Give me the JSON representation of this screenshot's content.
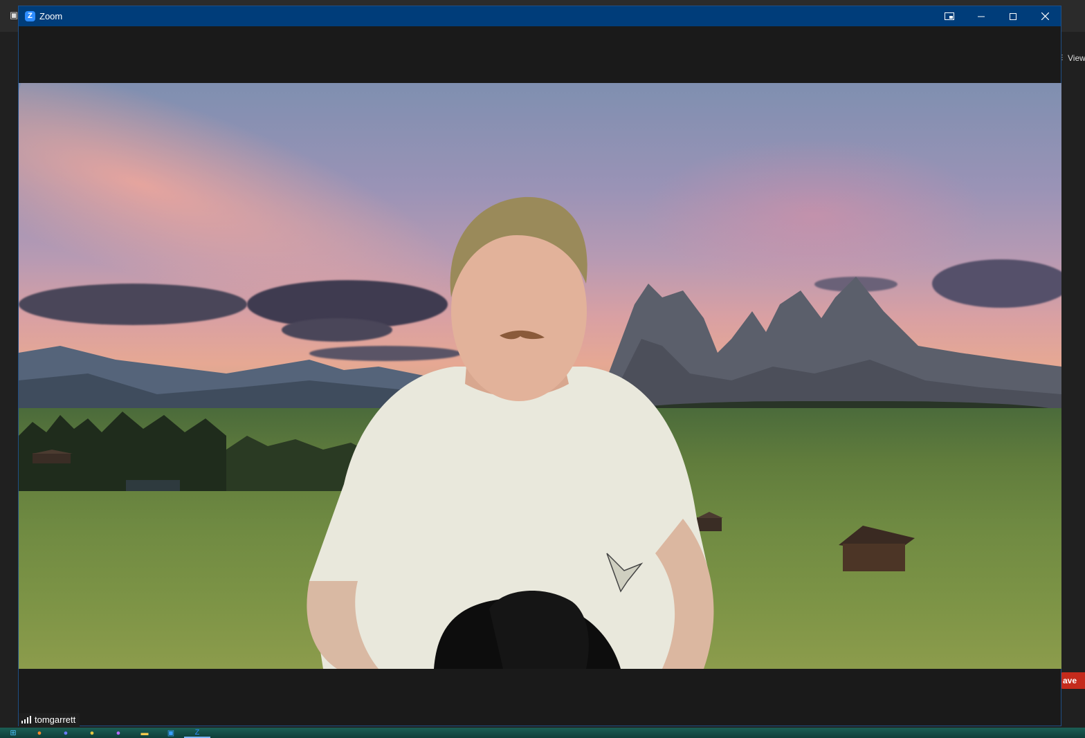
{
  "window": {
    "title": "Zoom",
    "controls": [
      "picture-in-picture-icon",
      "minimize-icon",
      "maximize-icon",
      "close-icon"
    ]
  },
  "background_app": {
    "view_label": "View",
    "leave_label": "ave"
  },
  "participant": {
    "name": "tomgarrett",
    "signal_bars": 4
  },
  "taskbar": {
    "items": [
      "windows-start-icon",
      "firefox-icon",
      "discord-icon",
      "chrome-icon",
      "messenger-icon",
      "file-explorer-icon",
      "photos-icon",
      "zoom-icon"
    ],
    "active": "zoom-icon"
  },
  "colors": {
    "titlebar": "#003d7a",
    "zoom_blue": "#2d8cff",
    "leave_red": "#c42b1c"
  }
}
